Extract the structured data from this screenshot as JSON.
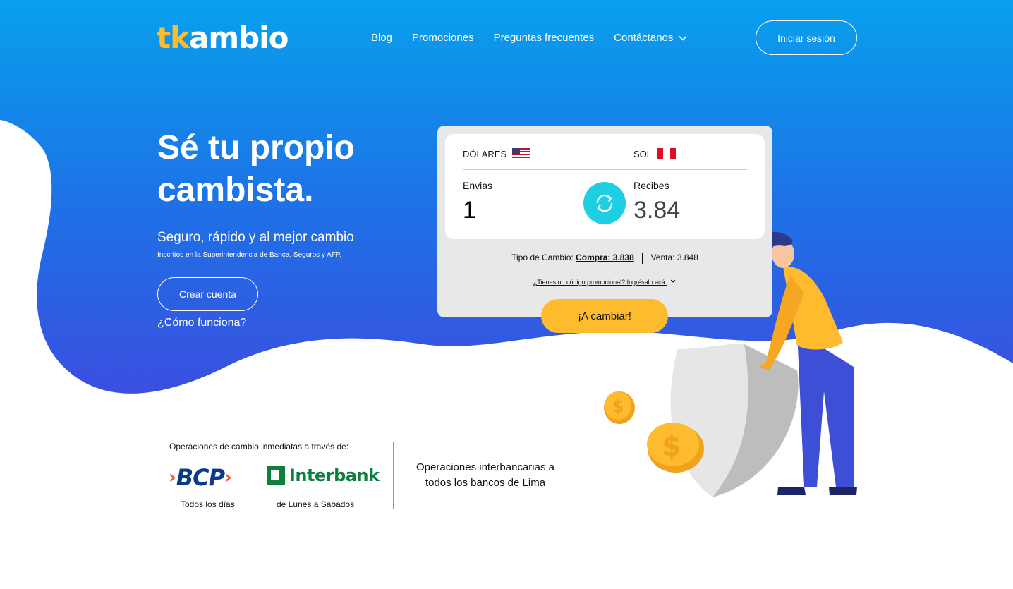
{
  "header": {
    "logo_part1": "tk",
    "logo_part2": "ambio",
    "nav": [
      {
        "label": "Blog"
      },
      {
        "label": "Promociones"
      },
      {
        "label": "Preguntas frecuentes"
      },
      {
        "label": "Contáctanos",
        "icon": "chevron-down-icon"
      }
    ],
    "login_label": "Iniciar sesión"
  },
  "hero": {
    "title": "Sé tu propio cambista.",
    "subtitle": "Seguro, rápido y al mejor cambio",
    "note": "Inscritos en la Superintendencia de Banca, Seguros y AFP.",
    "create_account_label": "Crear cuenta",
    "how_it_works_label": "¿Cómo funciona?"
  },
  "converter": {
    "from_currency": "DÓLARES",
    "to_currency": "SOL",
    "send_label": "Envias",
    "send_value": "1",
    "receive_label": "Recibes",
    "receive_value": "3.84",
    "rate_prefix": "Tipo de Cambio:",
    "buy_rate": "Compra: 3.838",
    "sell_rate": "Venta: 3.848",
    "promo_text": "¿Tienes un código promocional? Ingrésalo acá",
    "cta_label": "¡A cambiar!"
  },
  "banks": {
    "title": "Operaciones de cambio inmediatas a través de:",
    "bcp_name": "BCP",
    "bcp_schedule": "Todos los días",
    "interbank_name": "Interbank",
    "interbank_schedule": "de Lunes a Sábados",
    "interbank_ops": "Operaciones interbancarias a todos los bancos de Lima"
  },
  "colors": {
    "brand_blue": "#1a7ee6",
    "accent_yellow": "#FDBB2D",
    "swap_cyan": "#1ecfe3"
  }
}
